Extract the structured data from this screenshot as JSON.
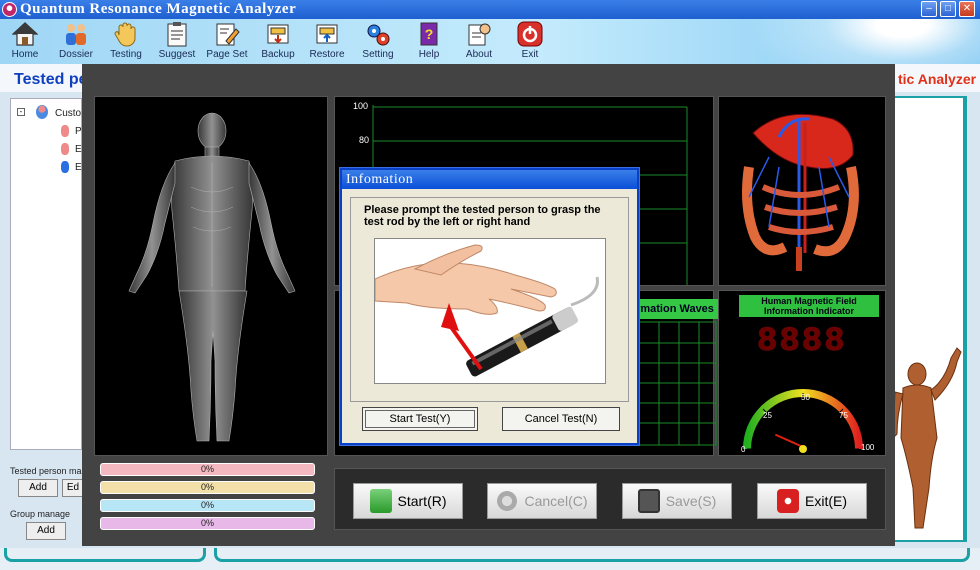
{
  "window": {
    "title": "Quantum Resonance Magnetic Analyzer",
    "min": "–",
    "max": "□",
    "close": "✕"
  },
  "toolbar": {
    "items": [
      {
        "label": "Home",
        "icon": "home-icon"
      },
      {
        "label": "Dossier",
        "icon": "users-icon"
      },
      {
        "label": "Testing",
        "icon": "hand-icon"
      },
      {
        "label": "Suggest",
        "icon": "clipboard-icon"
      },
      {
        "label": "Page Set",
        "icon": "page-set-icon"
      },
      {
        "label": "Backup",
        "icon": "backup-icon"
      },
      {
        "label": "Restore",
        "icon": "restore-icon"
      },
      {
        "label": "Setting",
        "icon": "gears-icon"
      },
      {
        "label": "Help",
        "icon": "help-book-icon"
      },
      {
        "label": "About",
        "icon": "about-icon"
      },
      {
        "label": "Exit",
        "icon": "power-icon"
      }
    ]
  },
  "background": {
    "tested_label": "Tested pe",
    "brand_fragment": "tic Analyzer",
    "tree_root": "Custo",
    "tree_children": [
      "P",
      "E",
      "E"
    ],
    "tested_person_group": "Tested person ma",
    "add": "Add",
    "edit_fragment": "Ed",
    "group_manage": "Group manage",
    "add2": "Add"
  },
  "chart": {
    "y_ticks": [
      "100",
      "80"
    ]
  },
  "waves": {
    "title": "rmation Waves"
  },
  "meter": {
    "title": "Human Magnetic Field Information Indicator",
    "digits": "8888",
    "gauge_labels": [
      "0",
      "25",
      "50",
      "75",
      "100"
    ],
    "needle_value": 5
  },
  "progress": [
    {
      "value": "0%",
      "color": "#f4b8c0"
    },
    {
      "value": "0%",
      "color": "#f3dfa8"
    },
    {
      "value": "0%",
      "color": "#b7e7f7"
    },
    {
      "value": "0%",
      "color": "#e8b8e8"
    }
  ],
  "buttons": {
    "start": "Start(R)",
    "cancel": "Cancel(C)",
    "save": "Save(S)",
    "exit": "Exit(E)"
  },
  "dialog": {
    "title": "Infomation",
    "prompt": "Please prompt the tested person to grasp the test rod by the left or right hand",
    "start_test": "Start Test(Y)",
    "cancel_test": "Cancel Test(N)"
  }
}
